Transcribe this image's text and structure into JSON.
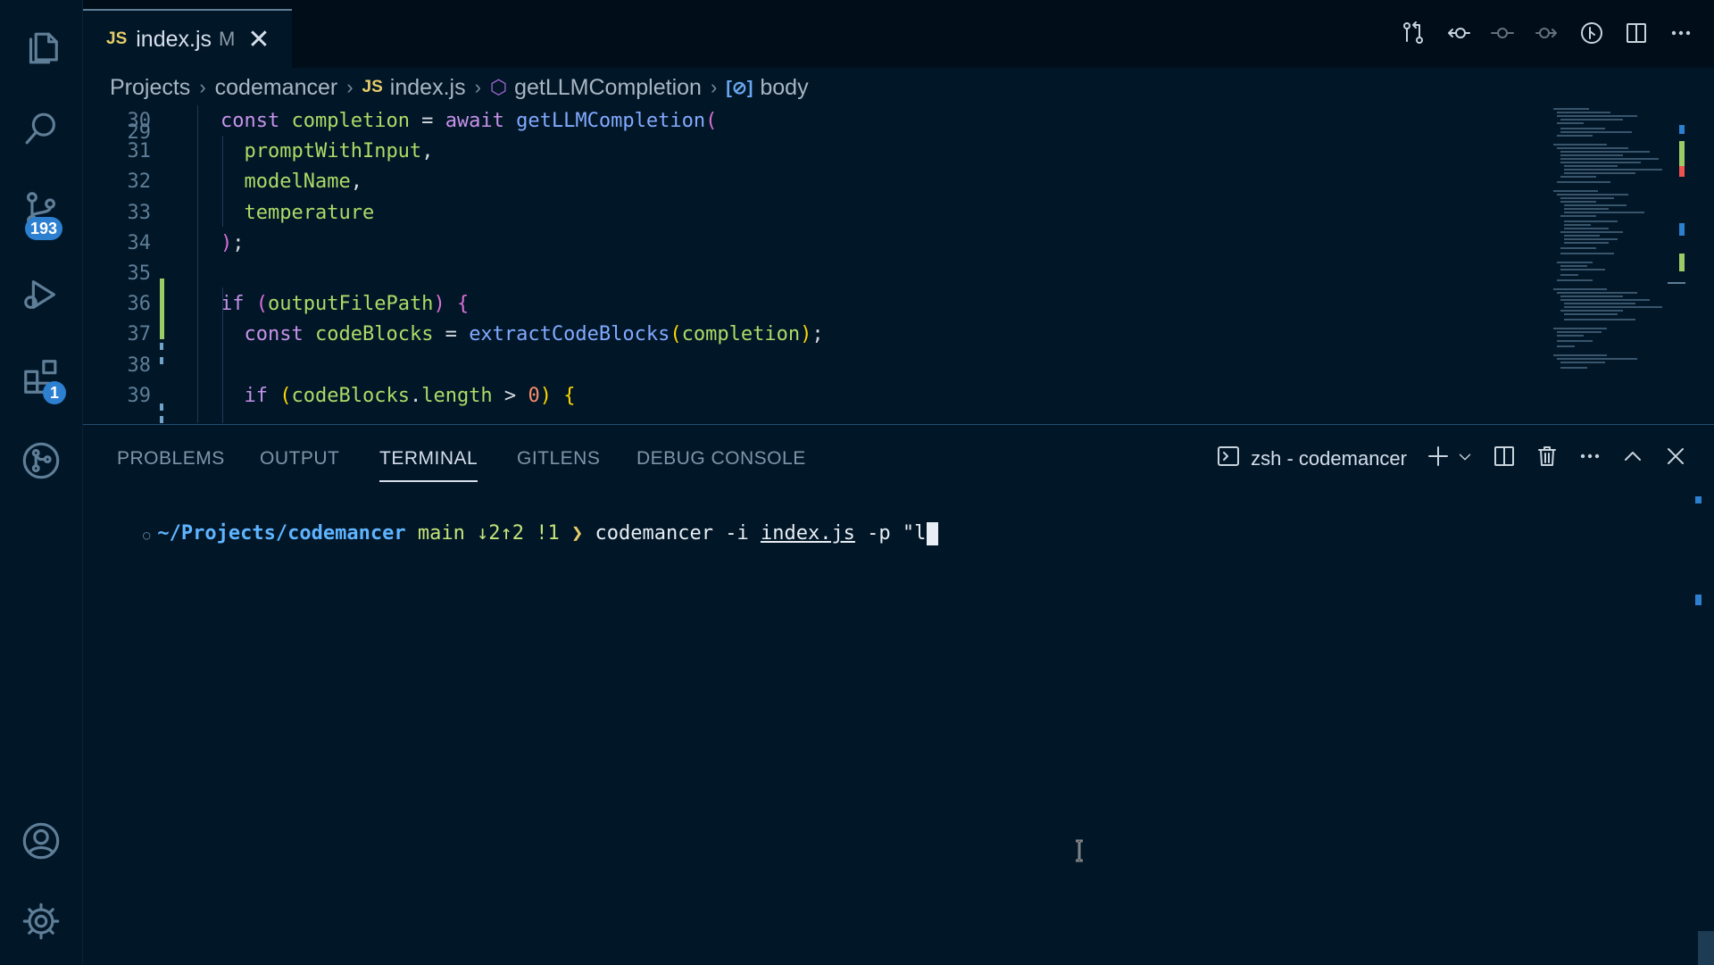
{
  "activity_bar": {
    "scm_badge": "193",
    "extensions_badge": "1"
  },
  "tab": {
    "lang_tag": "JS",
    "filename": "index.js",
    "status": "M"
  },
  "breadcrumb": {
    "items": [
      "Projects",
      "codemancer",
      "index.js",
      "getLLMCompletion",
      "body"
    ],
    "js_tag": "JS"
  },
  "editor": {
    "partial_line_number": "29",
    "lines": [
      {
        "n": "30",
        "parts": [
          [
            "kw",
            "const "
          ],
          [
            "var",
            "completion"
          ],
          [
            "prm",
            " = "
          ],
          [
            "kw",
            "await "
          ],
          [
            "fn",
            "getLLMCompletion"
          ],
          [
            "br2",
            "("
          ]
        ]
      },
      {
        "n": "31",
        "parts": [
          [
            "prm",
            "  "
          ],
          [
            "var",
            "promptWithInput"
          ],
          [
            "prm",
            ","
          ]
        ]
      },
      {
        "n": "32",
        "parts": [
          [
            "prm",
            "  "
          ],
          [
            "var",
            "modelName"
          ],
          [
            "prm",
            ","
          ]
        ]
      },
      {
        "n": "33",
        "parts": [
          [
            "prm",
            "  "
          ],
          [
            "var",
            "temperature"
          ]
        ]
      },
      {
        "n": "34",
        "parts": [
          [
            "br2",
            ")"
          ],
          [
            "prm",
            ";"
          ]
        ]
      },
      {
        "n": "35",
        "parts": []
      },
      {
        "n": "36",
        "parts": [
          [
            "kw",
            "if "
          ],
          [
            "br2",
            "("
          ],
          [
            "var",
            "outputFilePath"
          ],
          [
            "br2",
            ")"
          ],
          [
            "prm",
            " "
          ],
          [
            "br2",
            "{"
          ]
        ]
      },
      {
        "n": "37",
        "parts": [
          [
            "prm",
            "  "
          ],
          [
            "kw",
            "const "
          ],
          [
            "var",
            "codeBlocks"
          ],
          [
            "prm",
            " = "
          ],
          [
            "fn",
            "extractCodeBlocks"
          ],
          [
            "br1",
            "("
          ],
          [
            "var",
            "completion"
          ],
          [
            "br1",
            ")"
          ],
          [
            "prm",
            ";"
          ]
        ]
      },
      {
        "n": "38",
        "parts": []
      },
      {
        "n": "39",
        "parts": [
          [
            "prm",
            "  "
          ],
          [
            "kw",
            "if "
          ],
          [
            "br1",
            "("
          ],
          [
            "var",
            "codeBlocks"
          ],
          [
            "prm",
            "."
          ],
          [
            "prop",
            "length"
          ],
          [
            "prm",
            " > "
          ],
          [
            "num",
            "0"
          ],
          [
            "br1",
            ")"
          ],
          [
            "prm",
            " "
          ],
          [
            "br1",
            "{"
          ]
        ]
      }
    ]
  },
  "panel": {
    "tabs": [
      "PROBLEMS",
      "OUTPUT",
      "TERMINAL",
      "GITLENS",
      "DEBUG CONSOLE"
    ],
    "active_tab": "TERMINAL",
    "terminal_name": "zsh - codemancer"
  },
  "terminal": {
    "path": "~/Projects/codemancer",
    "git": "main ↓2↑2 !1",
    "prompt": "❯",
    "cmd_pre": "codemancer -i ",
    "cmd_file": "index.js",
    "cmd_post": " -p \"l"
  },
  "colors": {
    "background": "#011627",
    "accent": "#2d7fd0",
    "added_gutter": "#9ccc65"
  }
}
